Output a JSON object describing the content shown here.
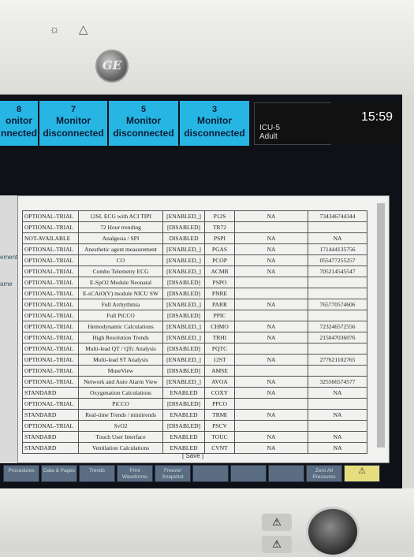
{
  "device": {
    "top_icons": "☼ △",
    "logo": "GE"
  },
  "alarm_cells": [
    {
      "num": "8",
      "line1": "onitor",
      "line2": "nnected"
    },
    {
      "num": "7",
      "line1": "Monitor",
      "line2": "disconnected"
    },
    {
      "num": "5",
      "line1": "Monitor",
      "line2": "disconnected"
    },
    {
      "num": "3",
      "line1": "Monitor",
      "line2": "disconnected"
    }
  ],
  "unit": {
    "name": "ICU-5",
    "type": "Adult"
  },
  "clock": "15:59",
  "left_labels": [
    "ement",
    "ame"
  ],
  "rows": [
    [
      "OPTIONAL-TRIAL",
      "12SL ECG with ACI TIPI",
      "[ENABLED_]",
      "P12S",
      "NA",
      "734346744344"
    ],
    [
      "OPTIONAL-TRIAL",
      "72 Hour trending",
      "[DISABLED]",
      "TR72",
      "",
      ""
    ],
    [
      "NOT-AVAILABLE",
      "Analgesia / SPI",
      "DISABLED",
      "PSPI",
      "NA",
      "NA"
    ],
    [
      "OPTIONAL-TRIAL",
      "Anesthetic agent measurement",
      "[ENABLED_]",
      "PGAS",
      "NA",
      "171444135756"
    ],
    [
      "OPTIONAL-TRIAL",
      "CO",
      "[ENABLED_]",
      "PCOP",
      "NA",
      "055477255257"
    ],
    [
      "OPTIONAL-TRIAL",
      "Combo Telemetry ECG",
      "[ENABLED_]",
      "ACMB",
      "NA",
      "705214545547"
    ],
    [
      "OPTIONAL-TRIAL",
      "E-SpO2 Module Neonatal",
      "[DISABLED]",
      "PSPO",
      "",
      ""
    ],
    [
      "OPTIONAL-TRIAL",
      "E-sCAiO(V) module NICU SW",
      "[DISABLED]",
      "PNRE",
      "",
      ""
    ],
    [
      "OPTIONAL-TRIAL",
      "Full Arrhythmia",
      "[ENABLED_]",
      "PARR",
      "NA",
      "765770574606"
    ],
    [
      "OPTIONAL-TRIAL",
      "Full PiCCO",
      "[DISABLED]",
      "PPIC",
      "",
      ""
    ],
    [
      "OPTIONAL-TRIAL",
      "Hemodynamic Calculations",
      "[ENABLED_]",
      "CHMO",
      "NA",
      "723246572556"
    ],
    [
      "OPTIONAL-TRIAL",
      "High Resolution Trends",
      "[ENABLED_]",
      "TRHI",
      "NA",
      "215047036076"
    ],
    [
      "OPTIONAL-TRIAL",
      "Multi-lead QT / QTc Analysis",
      "[DISABLED]",
      "PQTC",
      "",
      ""
    ],
    [
      "OPTIONAL-TRIAL",
      "Multi-lead ST Analysis",
      "[ENABLED_]",
      "12ST",
      "NA",
      "277621102765"
    ],
    [
      "OPTIONAL-TRIAL",
      "MuseView",
      "[DISABLED]",
      "AMSE",
      "",
      ""
    ],
    [
      "OPTIONAL-TRIAL",
      "Network and Auto Alarm View",
      "[ENABLED_]",
      "AVOA",
      "NA",
      "325566574577"
    ],
    [
      "STANDARD",
      "Oxygenation Calculations",
      "ENABLED",
      "COXY",
      "NA",
      "NA"
    ],
    [
      "OPTIONAL-TRIAL",
      "PiCCO",
      "[DISABLED]",
      "PPCO",
      "",
      ""
    ],
    [
      "STANDARD",
      "Real-time Trends / minitrends",
      "ENABLED",
      "TRMI",
      "NA",
      "NA"
    ],
    [
      "OPTIONAL-TRIAL",
      "SvO2",
      "[DISABLED]",
      "PSCV",
      "",
      ""
    ],
    [
      "STANDARD",
      "Touch User Interface",
      "ENABLED",
      "TOUC",
      "NA",
      "NA"
    ],
    [
      "STANDARD",
      "Ventilation Calculations",
      "ENABLED",
      "CVNT",
      "NA",
      "NA"
    ]
  ],
  "save_label": "[ Save ]",
  "softkeys": [
    "Procedures",
    "Data & Pages",
    "Trends",
    "Print Waveforms",
    "Freeze/ Snapshot",
    "",
    "",
    "",
    "Zero All Pressures",
    "⚠"
  ],
  "alarm_buttons": [
    "⚠",
    "⚠"
  ]
}
